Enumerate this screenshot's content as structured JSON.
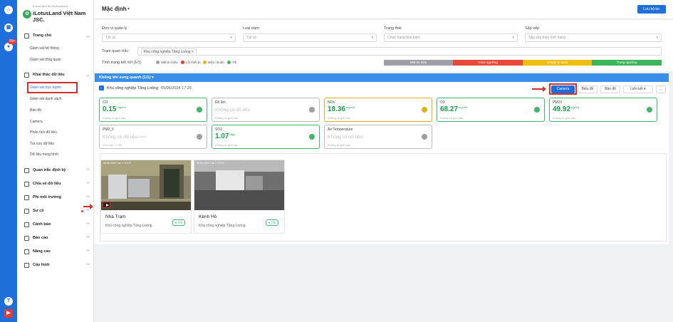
{
  "sidebar": {
    "brand_sub": "iLotusLand for Environment",
    "brand_name": "iLotusLand Việt Nam JSC.",
    "rail_badge": "99+",
    "groups": [
      {
        "label": "Trang chủ",
        "subs": [
          "Giám sát hệ thống",
          "Giám sát tổng quan"
        ]
      },
      {
        "label": "Khai thác dữ liệu",
        "subs": [
          "Giám sát trực tuyến",
          "Giám sát danh sách",
          "Bản đồ",
          "Camera",
          "Phân tích dữ liệu",
          "Tra cứu dữ liệu",
          "Dữ liệu trung bình"
        ]
      },
      {
        "label": "Quan trắc định kỳ"
      },
      {
        "label": "Chia sẻ dữ liệu"
      },
      {
        "label": "Phí môi trường"
      },
      {
        "label": "Sự cố"
      },
      {
        "label": "Cảnh báo"
      },
      {
        "label": "Báo cáo"
      },
      {
        "label": "Nâng cao"
      },
      {
        "label": "Cấu hình"
      }
    ]
  },
  "header": {
    "title": "Mặc định",
    "save_filter": "Lưu bộ lọc"
  },
  "filters": {
    "management_unit": {
      "label": "Đơn vị quản lý",
      "value": "Tất cả"
    },
    "station_type": {
      "label": "Loại trạm",
      "value": "Tất cả"
    },
    "status": {
      "label": "Trạng thái",
      "placeholder": "Chọn trạng thái trạm"
    },
    "sort": {
      "label": "Sắp xếp",
      "value": "Sắp xếp theo tình trạng"
    },
    "station_label": "Trạm quan trắc:",
    "station_tag": "Khu công nghiệp Tăng Loòng",
    "connection_label": "Tình trạng kết nối (1/1)",
    "legend": [
      "Mất tín hiệu",
      "Lỗi thiết bị",
      "Hiệu chuẩn",
      "Tốt"
    ],
    "status_bar": [
      "Mất tín hiệu",
      "Vượt ngưỡng",
      "Chuẩn bị vượt",
      "Trong ngưỡng"
    ]
  },
  "panel": {
    "title": "Không khí xung quanh (1/1)",
    "station_name": "Khu công nghiệp Tăng Loòng",
    "station_time": "05/06/2024 17:26",
    "buttons": {
      "camera": "Camera",
      "chart": "Biểu đồ",
      "map": "Bản đồ",
      "link": "Liên kết",
      "more": "..."
    }
  },
  "sensors": [
    {
      "name": "CO",
      "value": "0.15",
      "unit": "mg/m3",
      "limit": "Không có giới hạn",
      "status": "ok"
    },
    {
      "name": "Độ ẩm",
      "value": "Không có dữ liệu",
      "unit": "",
      "limit": "Không có giới hạn",
      "status": "na"
    },
    {
      "name": "NOx",
      "value": "18.36",
      "unit": "mg/m3",
      "limit": "Không có giới hạn",
      "status": "warn"
    },
    {
      "name": "O3",
      "value": "68.27",
      "unit": "mg/m3",
      "limit": "Không có giới hạn",
      "status": "ok"
    },
    {
      "name": "PM10",
      "value": "49.92",
      "unit": "µg/m3",
      "limit": "Không có giới hạn",
      "status": "ok"
    },
    {
      "name": "PM2_5",
      "value": "Không có dữ liệu",
      "unit": "µg/m3",
      "limit": "Giới hạn: ≤ 150",
      "status": "na"
    },
    {
      "name": "SO2",
      "value": "1.07",
      "unit": "mg/L",
      "limit": "Không có giới hạn",
      "status": "ok"
    },
    {
      "name": "Air Temperature",
      "value": "Không có dữ liệu",
      "unit": "",
      "limit": "Không có giới hạn",
      "status": "na"
    }
  ],
  "cameras": [
    {
      "title": "Nhà Trạm",
      "location": "Khu công nghiệp Tăng Loòng",
      "status": "Tốt",
      "timestamp": "05-06-2024 Tue 17:21:57"
    },
    {
      "title": "Kênh Hồ",
      "location": "Khu công nghiệp Tăng Loòng",
      "status": "Tốt",
      "timestamp": "05-06-2024 Tue 17:21:57"
    }
  ],
  "colors": {
    "primary": "#1e6fd9",
    "ok": "#43b66b",
    "warn": "#e0b020",
    "na": "#9e9e9e",
    "error": "#e53935"
  }
}
